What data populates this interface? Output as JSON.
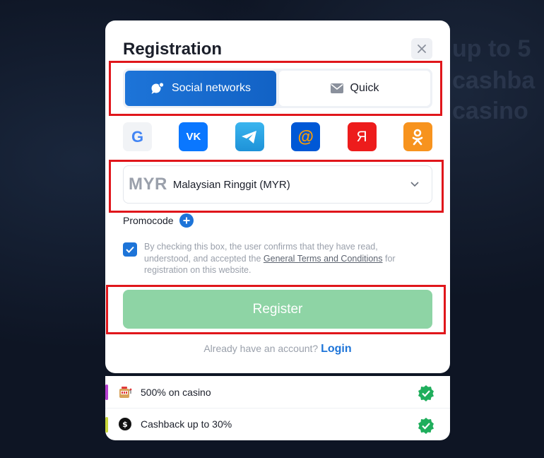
{
  "background": {
    "headline_fragments": [
      "up to 5",
      "cashba",
      "casino"
    ]
  },
  "modal": {
    "title": "Registration",
    "close_icon": "close-icon",
    "tabs": [
      {
        "label": "Social networks",
        "icon": "chat-bubble-icon",
        "active": true
      },
      {
        "label": "Quick",
        "icon": "envelope-icon",
        "active": false
      }
    ],
    "social_icons": [
      {
        "name": "google-icon",
        "label": "G"
      },
      {
        "name": "vk-icon",
        "label": "VK"
      },
      {
        "name": "telegram-icon",
        "label": ""
      },
      {
        "name": "mail-ru-icon",
        "label": "@"
      },
      {
        "name": "yandex-icon",
        "label": "Я"
      },
      {
        "name": "odnoklassniki-icon",
        "label": ""
      }
    ],
    "currency": {
      "code": "MYR",
      "name": "Malaysian Ringgit (MYR)"
    },
    "promocode_label": "Promocode",
    "consent": {
      "text_before": "By checking this box, the user confirms that they have read, understood, and accepted the ",
      "link": "General Terms and Conditions",
      "text_after": " for registration on this website.",
      "checked": true
    },
    "register_label": "Register",
    "login_prompt": "Already have an account?",
    "login_link": "Login"
  },
  "perks": [
    {
      "label": "500% on casino",
      "icon": "slot-machine-icon",
      "accent": "#b43fd0"
    },
    {
      "label": "Cashback up to 30%",
      "icon": "cashback-coin-icon",
      "accent": "#c8d63a"
    }
  ],
  "colors": {
    "primary": "#1d74d8",
    "register_disabled": "#8ed4a5",
    "highlight_box": "#e0161b",
    "check_green": "#1fae5c"
  }
}
